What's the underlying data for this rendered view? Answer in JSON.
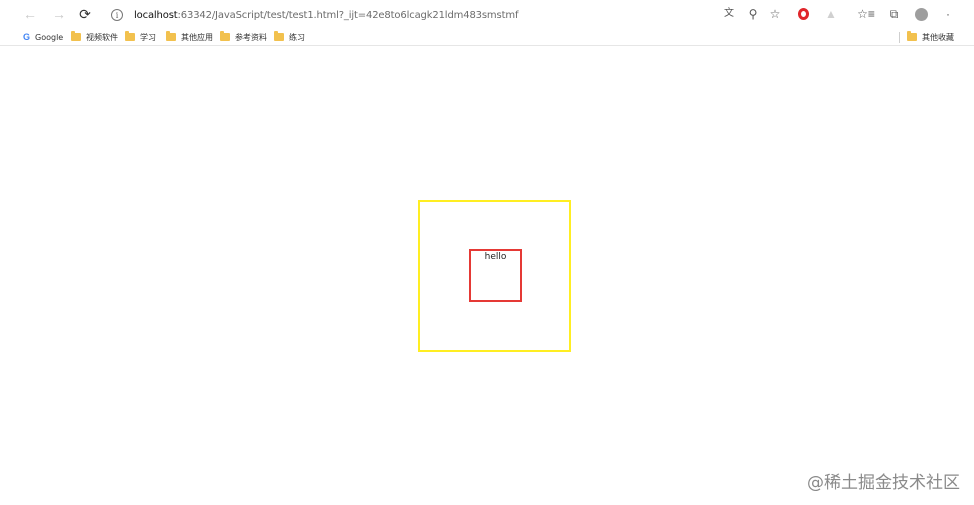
{
  "browser": {
    "url_host": "localhost",
    "url_rest": ":63342/JavaScript/test/test1.html?_ijt=42e8to6lcagk21ldm483smstmf",
    "icons": {
      "back": "arrow-left-icon",
      "forward": "arrow-right-icon",
      "reload": "reload-icon",
      "info": "info-icon",
      "translate": "translate-icon",
      "zoom": "zoom-icon",
      "favorite": "star-icon",
      "opera": "opera-icon",
      "extension": "extension-icon",
      "favorites_list": "favorites-list-icon",
      "collections": "collections-icon",
      "profile": "profile-icon",
      "more": "more-icon"
    }
  },
  "bookmarks": {
    "items": [
      {
        "label": "Google",
        "icon": "google-icon"
      },
      {
        "label": "视频软件",
        "icon": "folder-icon"
      },
      {
        "label": "学习",
        "icon": "folder-icon"
      },
      {
        "label": "其他应用",
        "icon": "folder-icon"
      },
      {
        "label": "参考资料",
        "icon": "folder-icon"
      },
      {
        "label": "练习",
        "icon": "folder-icon"
      }
    ],
    "other": {
      "label": "其他收藏",
      "icon": "folder-icon"
    }
  },
  "page": {
    "inner_text": "hello",
    "outer_border_color": "#ffee22",
    "inner_border_color": "#e53935"
  },
  "watermark": "@稀土掘金技术社区"
}
